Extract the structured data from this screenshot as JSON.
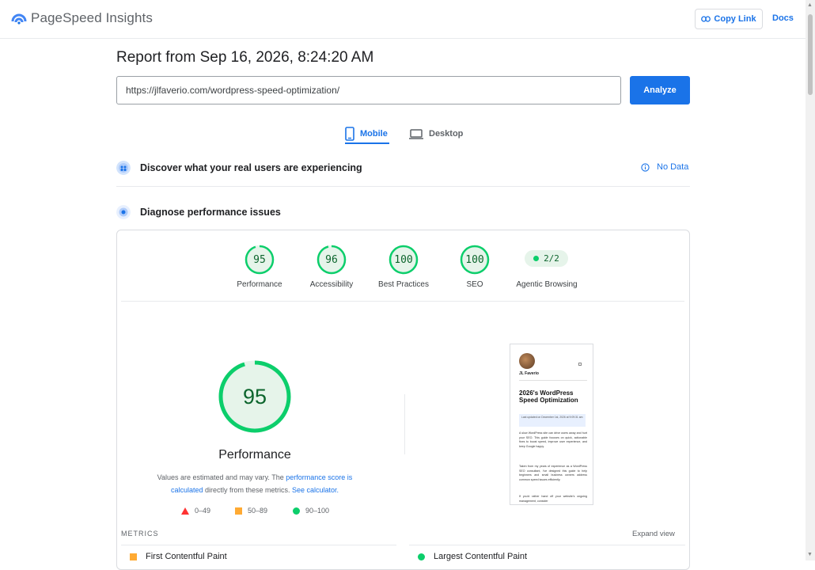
{
  "app": {
    "name": "PageSpeed Insights",
    "copy_link": "Copy Link",
    "docs": "Docs"
  },
  "report": {
    "title": "Report from Sep 16, 2026, 8:24:20 AM",
    "url": "https://jlfaverio.com/wordpress-speed-optimization/",
    "analyze": "Analyze"
  },
  "tabs": [
    {
      "label": "Mobile",
      "active": true
    },
    {
      "label": "Desktop",
      "active": false
    }
  ],
  "field_data": {
    "title": "Discover what your real users are experiencing",
    "status": "No Data"
  },
  "diagnose": {
    "title": "Diagnose performance issues"
  },
  "categories": [
    {
      "label": "Performance",
      "score": "95",
      "fraction": 0.95
    },
    {
      "label": "Accessibility",
      "score": "96",
      "fraction": 0.96
    },
    {
      "label": "Best Practices",
      "score": "100",
      "fraction": 1.0
    },
    {
      "label": "SEO",
      "score": "100",
      "fraction": 1.0
    }
  ],
  "agentic": {
    "label": "Agentic Browsing",
    "value": "2/2"
  },
  "performance": {
    "score": "95",
    "fraction": 0.95,
    "title": "Performance",
    "desc_1": "Values are estimated and may vary. The ",
    "desc_link_1": "performance score is calculated",
    "desc_2": " directly from these metrics. ",
    "desc_link_2": "See calculator."
  },
  "legend": [
    {
      "range": "0–49",
      "color": "#ff3333",
      "shape": "triangle"
    },
    {
      "range": "50–89",
      "color": "#ffaa33",
      "shape": "square"
    },
    {
      "range": "90–100",
      "color": "#0cce6b",
      "shape": "circle"
    }
  ],
  "screenshot": {
    "author": "JL Faverio",
    "heading": "2026's WordPress Speed Optimization",
    "updated": "Last updated on December 1st, 2026 at 9:09:31 am",
    "para_1": "A slow WordPress site can drive users away and hurt your SEO. This guide focuses on quick, actionable fixes to boost speed, improve user experience, and keep Google happy.",
    "para_2": "Taken from my years of experience as a WordPress SEO consultant, I've designed this guide to help beginners and small business owners address common speed issues efficiently.",
    "para_3": "If you'd rather hand off your website's ongoing management, consider"
  },
  "metrics": {
    "label": "METRICS",
    "expand": "Expand view",
    "items": [
      {
        "name": "First Contentful Paint",
        "status": "average"
      },
      {
        "name": "Largest Contentful Paint",
        "status": "good"
      }
    ]
  },
  "colors": {
    "accent": "#1a73e8",
    "good": "#0cce6b",
    "good_text": "#0d652d",
    "good_bg": "#e6f4ea",
    "average": "#ffaa33",
    "poor": "#ff3333"
  }
}
